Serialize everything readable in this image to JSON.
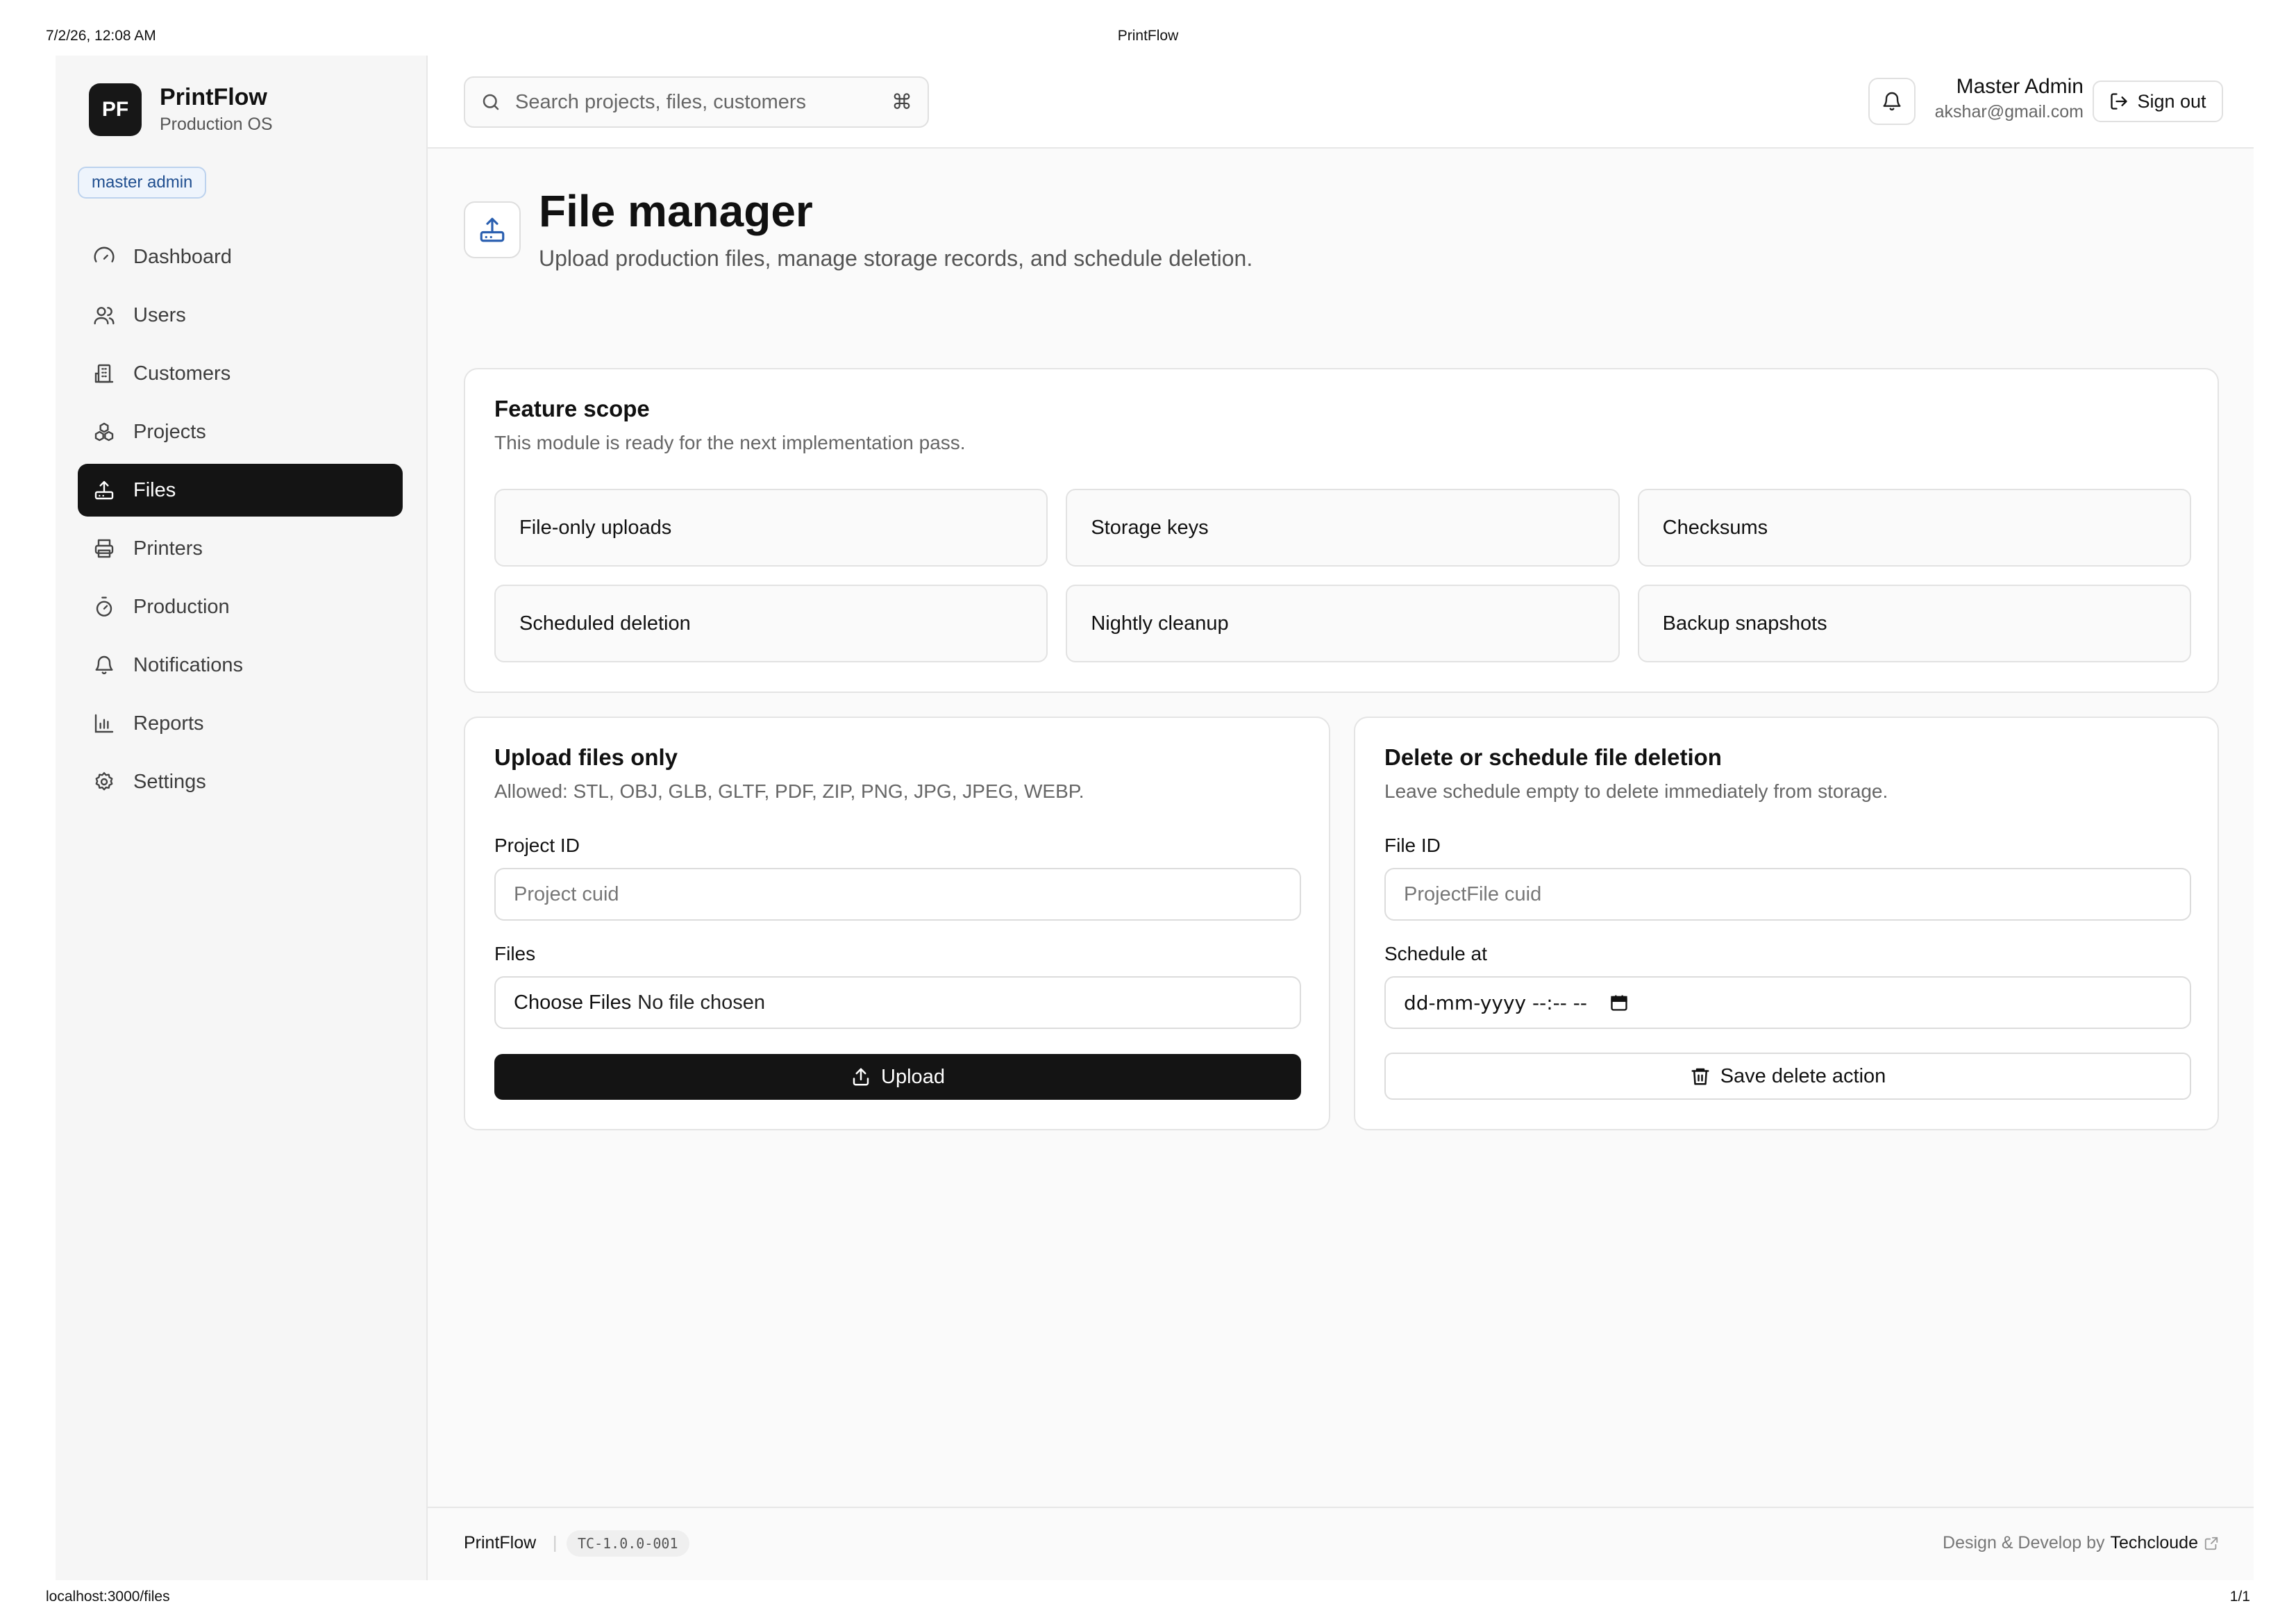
{
  "print": {
    "datetime": "7/2/26, 12:08 AM",
    "title": "PrintFlow",
    "url": "localhost:3000/files",
    "page": "1/1"
  },
  "brand": {
    "logo": "PF",
    "name": "PrintFlow",
    "subtitle": "Production OS",
    "role_badge": "master admin"
  },
  "sidebar": {
    "items": [
      {
        "label": "Dashboard",
        "icon": "gauge-icon"
      },
      {
        "label": "Users",
        "icon": "users-icon"
      },
      {
        "label": "Customers",
        "icon": "building-icon"
      },
      {
        "label": "Projects",
        "icon": "boxes-icon"
      },
      {
        "label": "Files",
        "icon": "upload-tray-icon",
        "active": true
      },
      {
        "label": "Printers",
        "icon": "printer-icon"
      },
      {
        "label": "Production",
        "icon": "timer-icon"
      },
      {
        "label": "Notifications",
        "icon": "bell-icon"
      },
      {
        "label": "Reports",
        "icon": "bar-chart-icon"
      },
      {
        "label": "Settings",
        "icon": "gear-icon"
      }
    ]
  },
  "topbar": {
    "search_placeholder": "Search projects, files, customers",
    "search_shortcut": "⌘",
    "user_name": "Master Admin",
    "user_email": "akshar@gmail.com",
    "sign_out_label": "Sign out"
  },
  "page": {
    "title": "File manager",
    "subtitle": "Upload production files, manage storage records, and schedule deletion."
  },
  "feature_scope": {
    "title": "Feature scope",
    "subtitle": "This module is ready for the next implementation pass.",
    "items": [
      "File-only uploads",
      "Storage keys",
      "Checksums",
      "Scheduled deletion",
      "Nightly cleanup",
      "Backup snapshots"
    ]
  },
  "upload": {
    "title": "Upload files only",
    "subtitle": "Allowed: STL, OBJ, GLB, GLTF, PDF, ZIP, PNG, JPG, JPEG, WEBP.",
    "project_label": "Project ID",
    "project_placeholder": "Project cuid",
    "files_label": "Files",
    "files_button": "Choose Files",
    "files_status": "No file chosen",
    "submit_label": "Upload"
  },
  "delete": {
    "title": "Delete or schedule file deletion",
    "subtitle": "Leave schedule empty to delete immediately from storage.",
    "file_label": "File ID",
    "file_placeholder": "ProjectFile cuid",
    "schedule_label": "Schedule at",
    "schedule_placeholder": "dd-mm-yyyy --:-- --",
    "submit_label": "Save delete action"
  },
  "footer": {
    "brand": "PrintFlow",
    "separator": "|",
    "version": "TC-1.0.0-001",
    "credit_prefix": "Design & Develop by",
    "credit_company": "Techcloude"
  },
  "colors": {
    "accent_dark": "#141414",
    "badge_blue": "#1f4e8f",
    "icon_blue": "#2a5fb0"
  }
}
